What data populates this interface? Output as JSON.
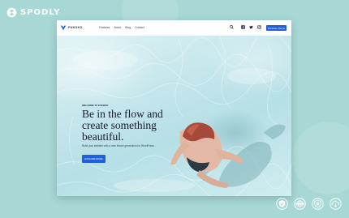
{
  "brand": {
    "name": "SPODLY",
    "logo_icon": "spodly-logo-icon"
  },
  "site": {
    "name": "PUKOKO",
    "nav": [
      "Features",
      "About",
      "Blog",
      "Contact"
    ],
    "icons": [
      "search-icon",
      "facebook-icon",
      "twitter-icon",
      "instagram-icon"
    ],
    "nav_button": "Purchase Theme"
  },
  "hero": {
    "eyebrow": "WELCOME TO PUKOKO",
    "headline_lines": [
      "Be in the flow and",
      "create something",
      "beautiful."
    ],
    "subtext": "Build your website with a new theme generation for WordPress.",
    "cta": "EXPLORE MORE"
  },
  "badges": [
    "shield-badge-icon",
    "globe-badge-icon",
    "secure-badge-icon",
    "cloud-download-badge-icon"
  ],
  "colors": {
    "background": "#a7d8d5",
    "accent": "#1f5fe0",
    "text_dark": "#141a2b",
    "water": "#c5e7ec"
  }
}
